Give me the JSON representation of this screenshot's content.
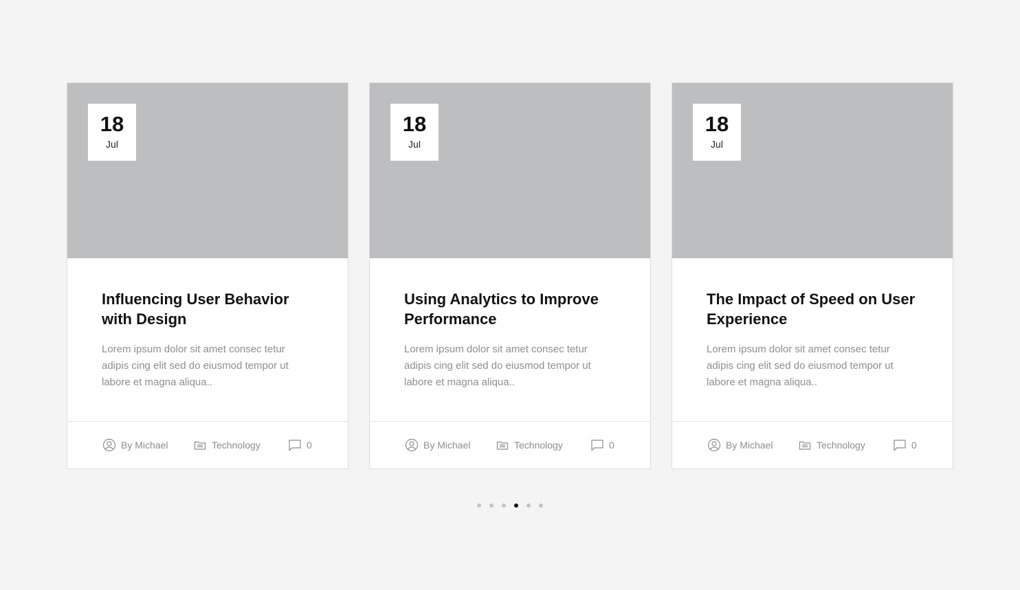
{
  "posts": [
    {
      "date_day": "18",
      "date_month": "Jul",
      "title": "Influencing User Behavior with Design",
      "excerpt": "Lorem ipsum dolor sit amet consec tetur adipis cing elit sed do eiusmod tempor ut labore et magna aliqua..",
      "author": "By Michael",
      "category": "Technology",
      "comments": "0"
    },
    {
      "date_day": "18",
      "date_month": "Jul",
      "title": "Using Analytics to Improve Performance",
      "excerpt": "Lorem ipsum dolor sit amet consec tetur adipis cing elit sed do eiusmod tempor ut labore et magna aliqua..",
      "author": "By Michael",
      "category": "Technology",
      "comments": "0"
    },
    {
      "date_day": "18",
      "date_month": "Jul",
      "title": "The Impact of Speed on User Experience",
      "excerpt": "Lorem ipsum dolor sit amet consec tetur adipis cing elit sed do eiusmod tempor ut labore et magna aliqua..",
      "author": "By Michael",
      "category": "Technology",
      "comments": "0"
    }
  ],
  "icons": {
    "author": "user-circle-icon",
    "category": "folder-icon",
    "comments": "comment-icon"
  },
  "pagination": {
    "total": 6,
    "active_index": 3
  },
  "colors": {
    "background": "#f4f4f4",
    "thumbnail_placeholder": "#bdbebf",
    "title": "#121212",
    "muted_text": "#8e8e8e",
    "dot_inactive": "#c4c4c4",
    "dot_active": "#111111"
  }
}
